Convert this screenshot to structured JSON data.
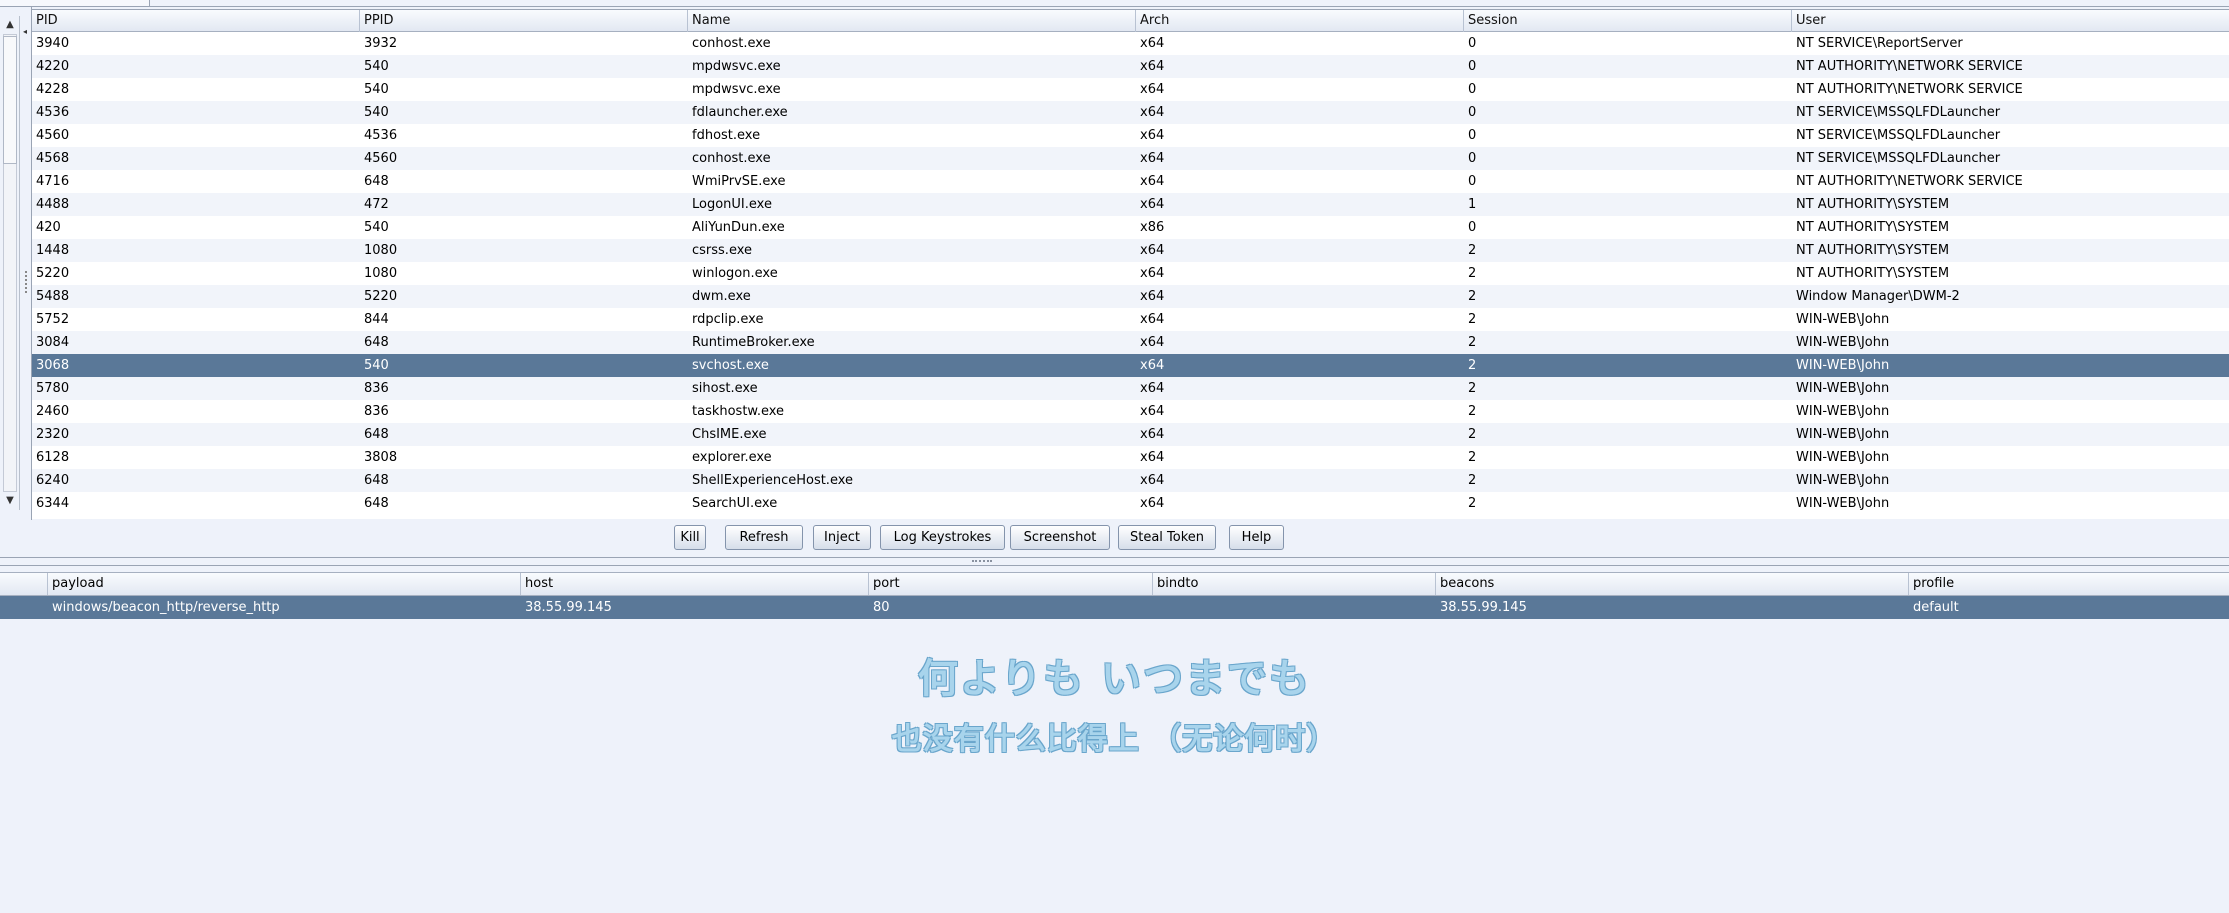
{
  "process_table": {
    "columns": [
      "PID",
      "PPID",
      "Name",
      "Arch",
      "Session",
      "User"
    ],
    "rows": [
      [
        "3940",
        "3932",
        "conhost.exe",
        "x64",
        "0",
        "NT SERVICE\\ReportServer"
      ],
      [
        "4220",
        "540",
        "mpdwsvc.exe",
        "x64",
        "0",
        "NT AUTHORITY\\NETWORK SERVICE"
      ],
      [
        "4228",
        "540",
        "mpdwsvc.exe",
        "x64",
        "0",
        "NT AUTHORITY\\NETWORK SERVICE"
      ],
      [
        "4536",
        "540",
        "fdlauncher.exe",
        "x64",
        "0",
        "NT SERVICE\\MSSQLFDLauncher"
      ],
      [
        "4560",
        "4536",
        "fdhost.exe",
        "x64",
        "0",
        "NT SERVICE\\MSSQLFDLauncher"
      ],
      [
        "4568",
        "4560",
        "conhost.exe",
        "x64",
        "0",
        "NT SERVICE\\MSSQLFDLauncher"
      ],
      [
        "4716",
        "648",
        "WmiPrvSE.exe",
        "x64",
        "0",
        "NT AUTHORITY\\NETWORK SERVICE"
      ],
      [
        "4488",
        "472",
        "LogonUI.exe",
        "x64",
        "1",
        "NT AUTHORITY\\SYSTEM"
      ],
      [
        "420",
        "540",
        "AliYunDun.exe",
        "x86",
        "0",
        "NT AUTHORITY\\SYSTEM"
      ],
      [
        "1448",
        "1080",
        "csrss.exe",
        "x64",
        "2",
        "NT AUTHORITY\\SYSTEM"
      ],
      [
        "5220",
        "1080",
        "winlogon.exe",
        "x64",
        "2",
        "NT AUTHORITY\\SYSTEM"
      ],
      [
        "5488",
        "5220",
        "dwm.exe",
        "x64",
        "2",
        "Window Manager\\DWM-2"
      ],
      [
        "5752",
        "844",
        "rdpclip.exe",
        "x64",
        "2",
        "WIN-WEB\\John"
      ],
      [
        "3084",
        "648",
        "RuntimeBroker.exe",
        "x64",
        "2",
        "WIN-WEB\\John"
      ],
      [
        "3068",
        "540",
        "svchost.exe",
        "x64",
        "2",
        "WIN-WEB\\John"
      ],
      [
        "5780",
        "836",
        "sihost.exe",
        "x64",
        "2",
        "WIN-WEB\\John"
      ],
      [
        "2460",
        "836",
        "taskhostw.exe",
        "x64",
        "2",
        "WIN-WEB\\John"
      ],
      [
        "2320",
        "648",
        "ChsIME.exe",
        "x64",
        "2",
        "WIN-WEB\\John"
      ],
      [
        "6128",
        "3808",
        "explorer.exe",
        "x64",
        "2",
        "WIN-WEB\\John"
      ],
      [
        "6240",
        "648",
        "ShellExperienceHost.exe",
        "x64",
        "2",
        "WIN-WEB\\John"
      ],
      [
        "6344",
        "648",
        "SearchUI.exe",
        "x64",
        "2",
        "WIN-WEB\\John"
      ]
    ],
    "selected_pid": "3068"
  },
  "buttons": {
    "kill": "Kill",
    "refresh": "Refresh",
    "inject": "Inject",
    "log_keystrokes": "Log Keystrokes",
    "screenshot": "Screenshot",
    "steal_token": "Steal Token",
    "help": "Help"
  },
  "listener_table": {
    "columns": [
      "payload",
      "host",
      "port",
      "bindto",
      "beacons",
      "profile"
    ],
    "rows": [
      [
        "windows/beacon_http/reverse_http",
        "38.55.99.145",
        "80",
        "",
        "38.55.99.145",
        "default"
      ]
    ]
  },
  "overlay": {
    "line1": "何よりも いつまでも",
    "line2": "也没有什么比得上 （无论何时）"
  },
  "colors": {
    "selection": "#5a7898",
    "background": "#eef2fa",
    "overlay_text": "#a8d4ec"
  }
}
